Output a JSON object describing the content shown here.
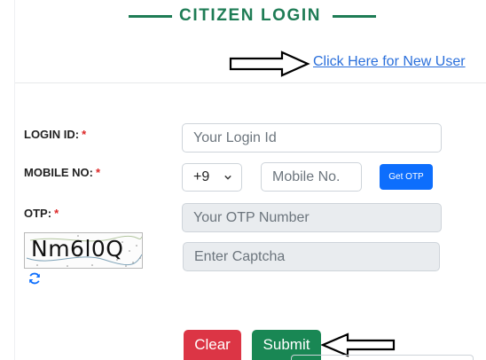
{
  "header": {
    "title": "CITIZEN LOGIN",
    "accent_color": "#1e7c55"
  },
  "links": {
    "new_user": "Click Here for New User"
  },
  "form": {
    "login_id": {
      "label": "LOGIN ID:",
      "required_mark": "*",
      "placeholder": "Your Login Id",
      "value": ""
    },
    "mobile": {
      "label": "MOBILE NO:",
      "required_mark": "*",
      "country_code": "+9",
      "placeholder": "Mobile No.",
      "value": "",
      "get_otp_label": "Get OTP"
    },
    "otp": {
      "label": "OTP:",
      "required_mark": "*",
      "placeholder": "Your OTP Number",
      "value": ""
    },
    "captcha": {
      "image_text": "Nm6l0Q",
      "placeholder": "Enter Captcha",
      "value": "",
      "refresh_icon": "refresh-icon"
    }
  },
  "buttons": {
    "clear_label": "Clear",
    "submit_label": "Submit",
    "clear_color": "#dc3545",
    "submit_color": "#198754",
    "otp_color": "#0d6efd"
  }
}
